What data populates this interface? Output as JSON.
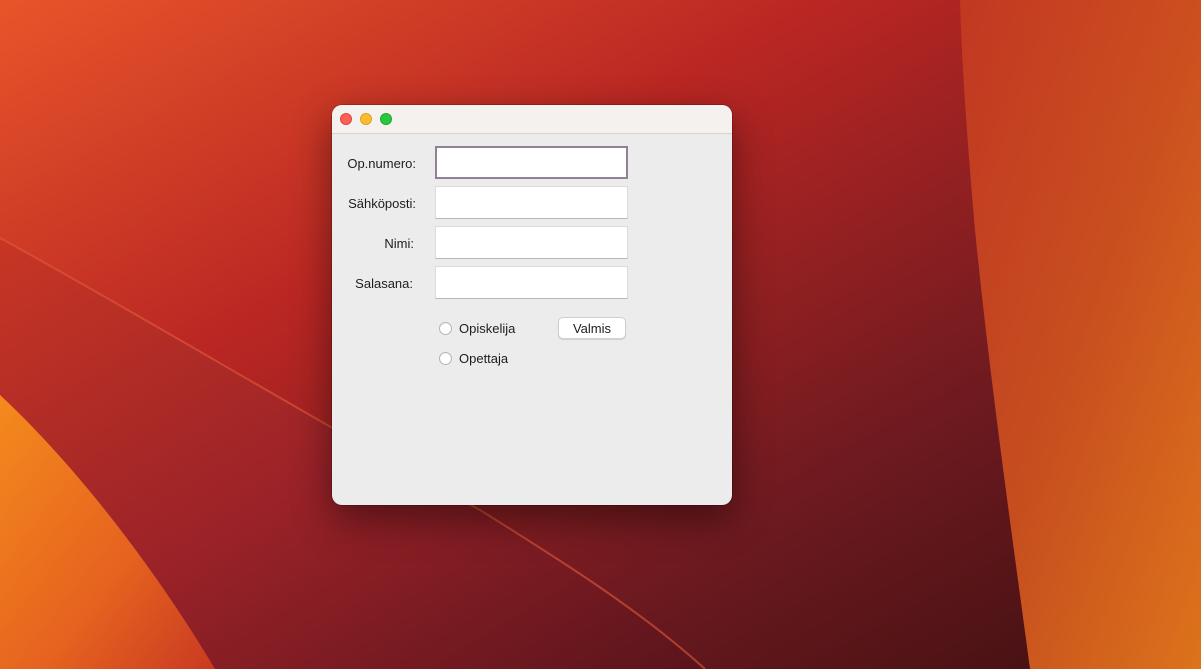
{
  "desktop": {
    "wallpaper_colors": [
      "#e8572a",
      "#b82424",
      "#7a1a22",
      "#4a1212",
      "#f08a1e"
    ]
  },
  "window": {
    "title": "",
    "controls": {
      "close": "close-icon",
      "minimize": "minimize-icon",
      "zoom": "zoom-icon"
    },
    "form": {
      "student_number": {
        "label": "Op.numero:",
        "value": "",
        "focused": true
      },
      "email": {
        "label": "Sähköposti:",
        "value": ""
      },
      "name": {
        "label": "Nimi:",
        "value": ""
      },
      "password": {
        "label": "Salasana:",
        "value": ""
      }
    },
    "role_options": [
      {
        "label": "Opiskelija",
        "selected": false
      },
      {
        "label": "Opettaja",
        "selected": false
      }
    ],
    "submit_label": "Valmis",
    "focus_ring_color": "#8f8296"
  }
}
